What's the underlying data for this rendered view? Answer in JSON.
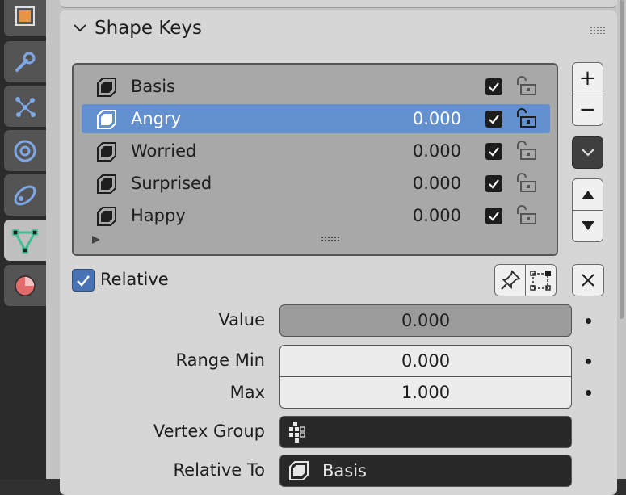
{
  "properties_tabs": [
    {
      "icon": "object-icon",
      "active": false
    },
    {
      "icon": "wrench-modifier-icon",
      "active": false
    },
    {
      "icon": "particles-icon",
      "active": false
    },
    {
      "icon": "physics-icon",
      "active": false
    },
    {
      "icon": "constraints-icon",
      "active": false
    },
    {
      "icon": "mesh-data-icon",
      "active": true
    },
    {
      "icon": "material-icon",
      "active": false
    }
  ],
  "panel": {
    "title": "Shape Keys",
    "expanded": true
  },
  "shape_keys": [
    {
      "name": "Basis",
      "value": "",
      "enabled": true,
      "selected": false
    },
    {
      "name": "Angry",
      "value": "0.000",
      "enabled": true,
      "selected": true
    },
    {
      "name": "Worried",
      "value": "0.000",
      "enabled": true,
      "selected": false
    },
    {
      "name": "Surprised",
      "value": "0.000",
      "enabled": true,
      "selected": false
    },
    {
      "name": "Happy",
      "value": "0.000",
      "enabled": true,
      "selected": false
    }
  ],
  "side_buttons": {
    "add": "+",
    "remove": "−"
  },
  "relative": {
    "label": "Relative",
    "checked": true
  },
  "properties": {
    "value": {
      "label": "Value",
      "field": "0.000"
    },
    "range_min": {
      "label": "Range Min",
      "field": "0.000"
    },
    "max": {
      "label": "Max",
      "field": "1.000"
    },
    "vertex_group": {
      "label": "Vertex Group",
      "field": ""
    },
    "relative_to": {
      "label": "Relative To",
      "field": "Basis"
    }
  },
  "colors": {
    "selection": "#6391d0",
    "checkbox_accent": "#4772b3",
    "mesh_icon": "#3fbf96"
  }
}
